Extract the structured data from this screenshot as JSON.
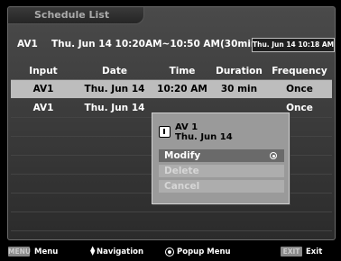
{
  "title": "Schedule List",
  "info": {
    "source": "AV1",
    "schedule_text": "Thu. Jun 14 10:20AM~10:50 AM(30min)",
    "clock": "Thu. Jun 14 10:18 AM"
  },
  "table": {
    "headers": [
      "Input",
      "Date",
      "Time",
      "Duration",
      "Frequency"
    ],
    "rows": [
      {
        "input": "AV1",
        "date": "Thu. Jun 14",
        "time": "10:20 AM",
        "duration": "30 min",
        "frequency": "Once"
      },
      {
        "input": "AV1",
        "date": "Thu. Jun 14",
        "time": "",
        "duration": "",
        "frequency": "Once"
      }
    ]
  },
  "popup": {
    "line1": "AV 1",
    "line2": "Thu. Jun 14",
    "items": [
      "Modify",
      "Delete",
      "Cancel"
    ],
    "icon": "info-icon"
  },
  "bottom": {
    "menu_key": "MENU",
    "menu_label": "Menu",
    "nav_label": "Navigation",
    "popup_label": "Popup Menu",
    "exit_key": "EXIT",
    "exit_label": "Exit"
  },
  "colors": {
    "selected_row": "#bdbdbd",
    "popup_bg": "#9a9a9a",
    "popup_active": "#6a6a6a"
  }
}
